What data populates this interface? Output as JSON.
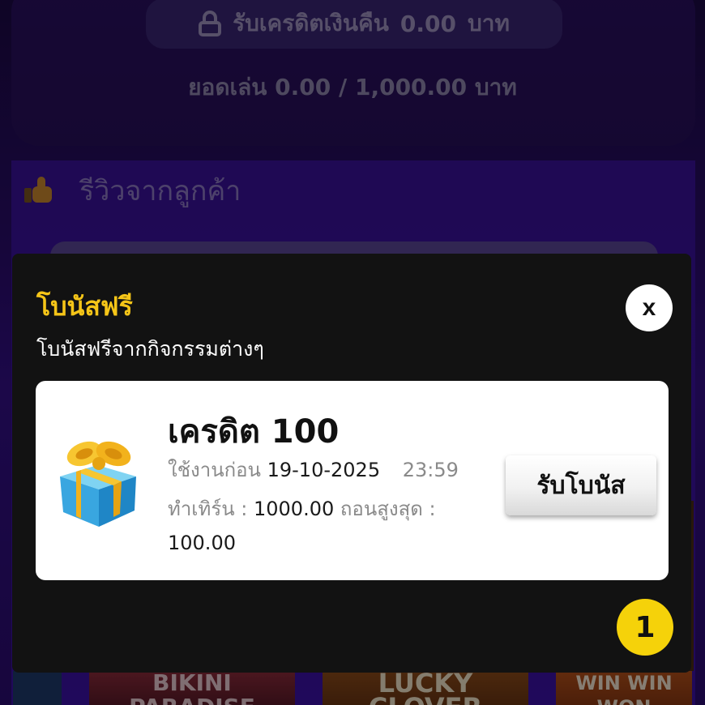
{
  "background": {
    "cashback_label": "รับเครดิตเงินคืน",
    "cashback_amount": "0.00",
    "cashback_unit": "บาท",
    "turnover_text": "ยอดเล่น 0.00 / 1,000.00 บาท",
    "review_heading": "รีวิวจากลูกค้า",
    "games": [
      "BIKINI PARADISE",
      "LUCKY CLOVER",
      "WIN WIN WON"
    ]
  },
  "modal": {
    "title": "โบนัสฟรี",
    "subtitle": "โบนัสฟรีจากกิจกรรมต่างๆ",
    "close_label": "x",
    "bonus": {
      "title": "เครดิต 100",
      "expire_label": "ใช้งานก่อน",
      "expire_date": "19-10-2025",
      "expire_time": "23:59",
      "turnover_label": "ทำเทิร์น",
      "separator": ":",
      "turnover_value": "1000.00",
      "max_withdraw_label": "ถอนสูงสุด",
      "max_withdraw_value": "100.00",
      "claim_button": "รับโบนัส"
    },
    "page_badge": "1"
  },
  "colors": {
    "modal_bg": "#121212",
    "title_accent": "#f5c518",
    "badge": "#f5d20a",
    "page_bg": "#2a0b6b"
  },
  "icons": [
    "lock-icon",
    "thumbs-up-icon",
    "gift-box-icon",
    "close-icon"
  ]
}
